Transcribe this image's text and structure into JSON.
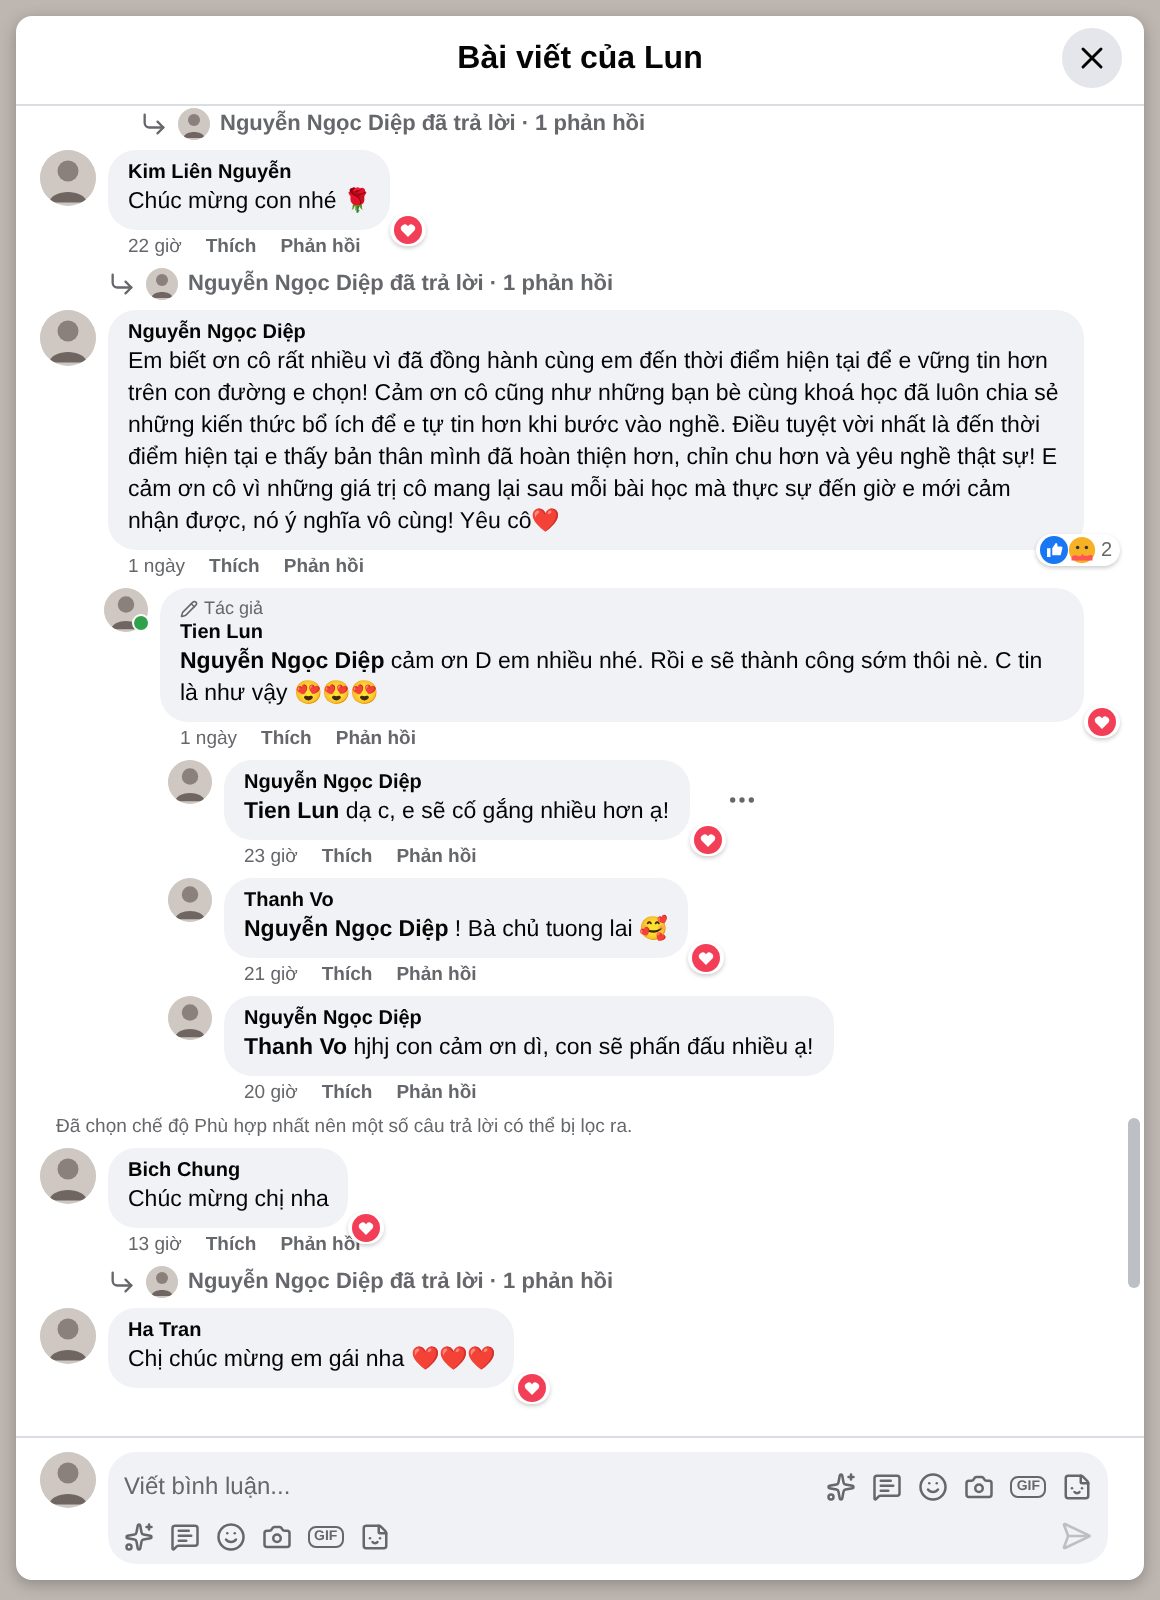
{
  "dialog": {
    "title": "Bài viết của Lun"
  },
  "thread": [
    {
      "kind": "reply_summary",
      "text": "Nguyễn Ngọc Diệp đã trả lời · 1 phản hồi"
    },
    {
      "kind": "comment",
      "author": "Kim Liên Nguyễn",
      "text": "Chúc mừng con nhé 🌹",
      "reactions": [
        {
          "kind": "love"
        }
      ],
      "time": "22 giờ",
      "actions": [
        "Thích",
        "Phản hồi"
      ],
      "reply_summary": "Nguyễn Ngọc Diệp đã trả lời · 1 phản hồi"
    },
    {
      "kind": "comment",
      "author": "Nguyễn Ngọc Diệp",
      "text": "Em biết ơn cô rất nhiều vì đã đồng hành cùng em đến thời điểm hiện tại để e vững tin hơn trên con đường e chọn! Cảm ơn cô cũng như những bạn bè cùng khoá học đã luôn chia sẻ những kiến thức bổ ích để e tự tin hơn khi bước vào nghề. Điều tuyệt vời nhất là đến thời điểm hiện tại e thấy bản thân mình đã hoàn thiện hơn, chỉn chu hơn và yêu nghề thật sự! E cảm ơn cô vì những giá trị cô mang lại sau mỗi bài học mà thực sự đến giờ e mới cảm nhận được, nó ý nghĩa vô cùng! Yêu cô❤️",
      "reactions": [
        {
          "kind": "like"
        },
        {
          "kind": "care"
        }
      ],
      "reaction_count": "2",
      "time": "1 ngày",
      "actions": [
        "Thích",
        "Phản hồi"
      ],
      "children": [
        {
          "badge": "Tác giả",
          "author": "Tien Lun",
          "online": true,
          "text": "**Nguyễn Ngọc Diệp** cảm ơn D em nhiều nhé. Rồi e sẽ thành công sớm thôi nè. C tin là như vậy 😍😍😍",
          "reactions": [
            {
              "kind": "love"
            }
          ],
          "time": "1 ngày",
          "actions": [
            "Thích",
            "Phản hồi"
          ],
          "children": [
            {
              "author": "Nguyễn Ngọc Diệp",
              "text": "**Tien Lun** dạ c, e sẽ cố gắng nhiều hơn ạ!",
              "reactions": [
                {
                  "kind": "love"
                }
              ],
              "more_button": true,
              "time": "23 giờ",
              "actions": [
                "Thích",
                "Phản hồi"
              ]
            },
            {
              "author": "Thanh Vo",
              "text": "**Nguyễn Ngọc Diệp** ! Bà chủ tuong lai 🥰",
              "reactions": [
                {
                  "kind": "love"
                }
              ],
              "time": "21 giờ",
              "actions": [
                "Thích",
                "Phản hồi"
              ]
            },
            {
              "author": "Nguyễn Ngọc Diệp",
              "text": "**Thanh Vo** hjhj con cảm ơn dì, con sẽ phấn đấu nhiều ạ!",
              "time": "20 giờ",
              "actions": [
                "Thích",
                "Phản hồi"
              ]
            }
          ]
        }
      ]
    },
    {
      "kind": "notice",
      "text": "Đã chọn chế độ Phù hợp nhất nên một số câu trả lời có thể bị lọc ra."
    },
    {
      "kind": "comment",
      "author": "Bich Chung",
      "text": "Chúc mừng chị nha",
      "reactions": [
        {
          "kind": "love"
        }
      ],
      "time": "13 giờ",
      "actions": [
        "Thích",
        "Phản hồi"
      ],
      "reply_summary": "Nguyễn Ngọc Diệp đã trả lời · 1 phản hồi"
    },
    {
      "kind": "comment",
      "author": "Ha Tran",
      "text": "Chị chúc mừng em gái nha ❤️❤️❤️",
      "reactions": [
        {
          "kind": "love"
        }
      ]
    }
  ],
  "composer": {
    "placeholder": "Viết bình luận...",
    "tool_rows": [
      {
        "gif": "GIF"
      },
      {
        "gif": "GIF"
      }
    ],
    "send_disabled": true
  }
}
